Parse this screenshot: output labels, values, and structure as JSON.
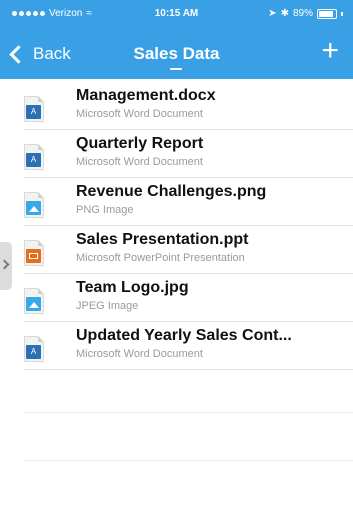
{
  "status_bar": {
    "carrier": "Verizon",
    "time": "10:15 AM",
    "battery": "89%"
  },
  "nav": {
    "back_label": "Back",
    "title": "Sales Data",
    "add_label": "+"
  },
  "files": [
    {
      "name": "Management.docx",
      "type": "Microsoft Word Document",
      "icon": "word-doc-icon",
      "badge": "A"
    },
    {
      "name": "Quarterly Report",
      "type": "Microsoft Word Document",
      "icon": "word-doc-icon",
      "badge": "A"
    },
    {
      "name": "Revenue Challenges.png",
      "type": "PNG Image",
      "icon": "image-file-icon",
      "badge": ""
    },
    {
      "name": "Sales Presentation.ppt",
      "type": "Microsoft PowerPoint Presentation",
      "icon": "powerpoint-file-icon",
      "badge": ""
    },
    {
      "name": "Team Logo.jpg",
      "type": "JPEG Image",
      "icon": "image-file-icon",
      "badge": ""
    },
    {
      "name": "Updated Yearly Sales Cont...",
      "type": "Microsoft Word Document",
      "icon": "word-doc-icon",
      "badge": "A"
    }
  ],
  "colors": {
    "header": "#3aa0e6",
    "word": "#2b6fb6",
    "image": "#38a8e8",
    "ppt": "#e86c1f"
  }
}
